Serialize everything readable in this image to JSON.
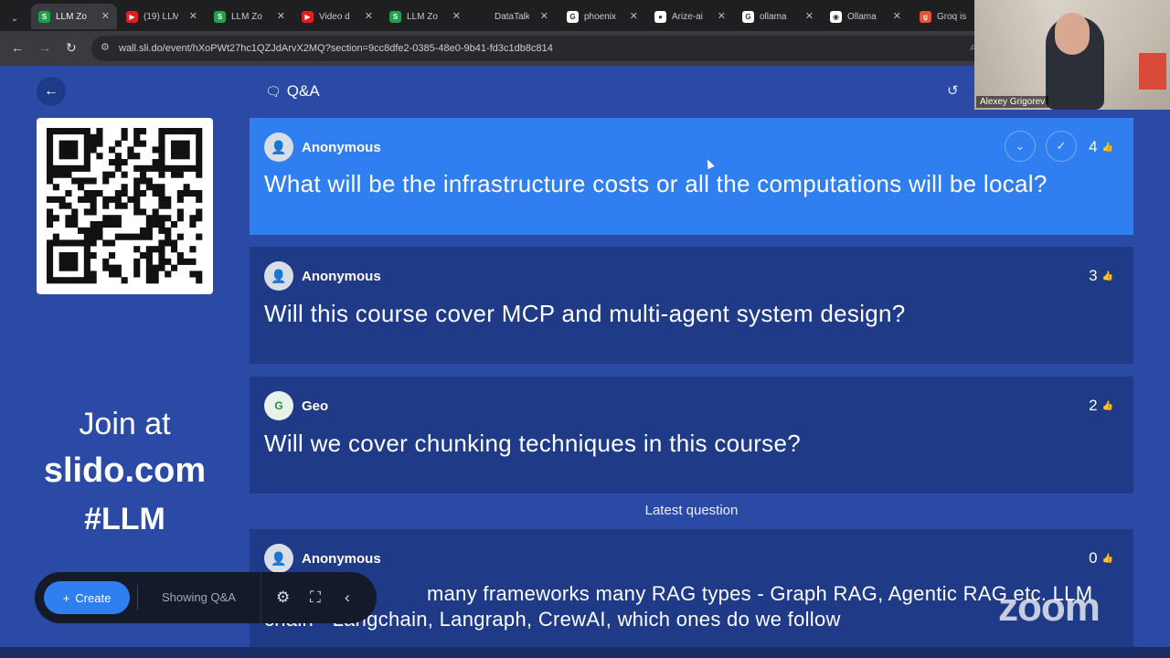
{
  "browser": {
    "tabs": [
      {
        "label": "LLM Zo",
        "icon": "slido-icon",
        "color": "#1fa04a",
        "glyph": "S",
        "active": true
      },
      {
        "label": "(19) LLM",
        "icon": "youtube-icon",
        "color": "#e02020",
        "glyph": "▶",
        "active": false
      },
      {
        "label": "LLM Zo",
        "icon": "slido-icon",
        "color": "#1fa04a",
        "glyph": "S",
        "active": false
      },
      {
        "label": "Video d",
        "icon": "youtube-icon",
        "color": "#e02020",
        "glyph": "▶",
        "active": false
      },
      {
        "label": "LLM Zo",
        "icon": "slido-icon",
        "color": "#1fa04a",
        "glyph": "S",
        "active": false
      },
      {
        "label": "DataTalk",
        "icon": "datatalks-icon",
        "color": "#1f1f22",
        "glyph": "",
        "active": false
      },
      {
        "label": "phoenix",
        "icon": "google-icon",
        "color": "#ffffff",
        "glyph": "G",
        "active": false
      },
      {
        "label": "Arize-ai",
        "icon": "github-icon",
        "color": "#ffffff",
        "glyph": "●",
        "active": false
      },
      {
        "label": "ollama",
        "icon": "google-icon",
        "color": "#ffffff",
        "glyph": "G",
        "active": false
      },
      {
        "label": "Ollama",
        "icon": "ollama-icon",
        "color": "#ffffff",
        "glyph": "◉",
        "active": false
      },
      {
        "label": "Groq is",
        "icon": "groq-icon",
        "color": "#e8543a",
        "glyph": "g",
        "active": false
      }
    ],
    "url": "wall.sli.do/event/hXoPWt27hc1QZJdArvX2MQ?section=9cc8dfe2-0385-48e0-9b41-fd3c1db8c814"
  },
  "sidebar": {
    "join_line1": "Join at",
    "join_line2": "slido.com",
    "join_line3": "#LLM"
  },
  "header": {
    "title": "Q&A"
  },
  "questions": [
    {
      "author": "Anonymous",
      "text": "What will be the infrastructure costs or all the computations will be local?",
      "votes": "4",
      "highlighted": true
    },
    {
      "author": "Anonymous",
      "text": "Will this course cover MCP and multi-agent system design?",
      "votes": "3",
      "highlighted": false
    },
    {
      "author": "Geo",
      "avatar_letter": "G",
      "text": "Will we cover chunking techniques in this course?",
      "votes": "2",
      "highlighted": false
    }
  ],
  "latest_label": "Latest question",
  "latest_question": {
    "author": "Anonymous",
    "line1": "many frameworks many RAG types - Graph RAG, Agentic RAG etc. LLM",
    "line2": "Langchain, Langraph, CrewAI, which ones do we follow",
    "line2_prefix": "chain -",
    "votes": "0"
  },
  "toolbar": {
    "create_label": "Create",
    "showing_label": "Showing Q&A"
  },
  "zoom": {
    "participant_name": "Alexey Grigorev",
    "logo_text": "zoom"
  },
  "colors": {
    "background": "#2a4aa6",
    "card": "#1f3a86",
    "highlight": "#2f7ff0"
  }
}
